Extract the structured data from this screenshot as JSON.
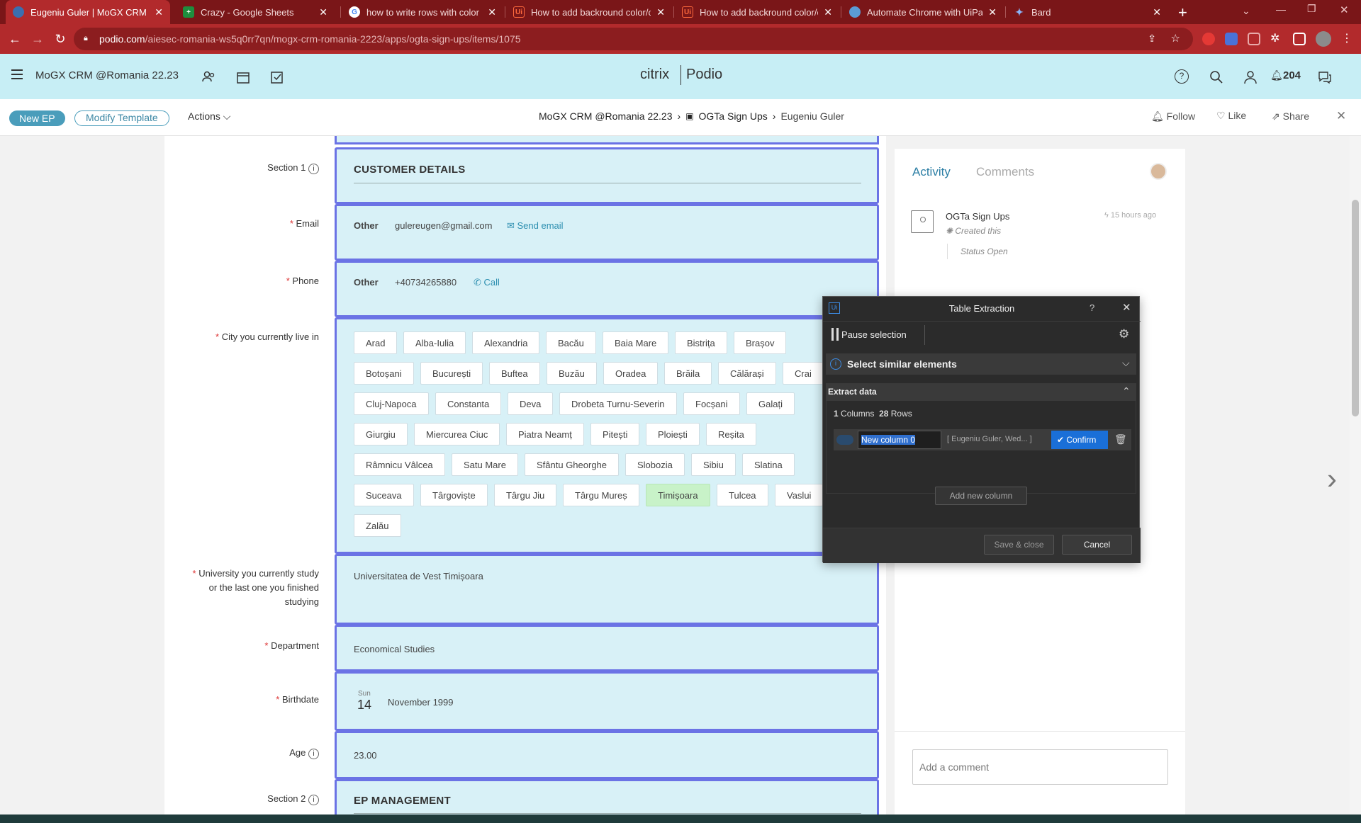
{
  "browser": {
    "tabs": [
      {
        "title": "Eugeniu Guler | MoGX CRM @R",
        "active": true
      },
      {
        "title": "Crazy - Google Sheets"
      },
      {
        "title": "how to write rows with color in"
      },
      {
        "title": "How to add backround color/ce"
      },
      {
        "title": "How to add backround color/ce"
      },
      {
        "title": "Automate Chrome with UiPath"
      },
      {
        "title": "Bard"
      }
    ],
    "url_host": "podio.com",
    "url_path": "/aiesec-romania-ws5q0rr7qn/mogx-crm-romania-2223/apps/ogta-sign-ups/items/1075"
  },
  "header": {
    "workspace": "MoGX CRM @Romania 22.23",
    "logo_left": "citrix",
    "logo_right": "Podio",
    "notifications": "204"
  },
  "toolbar": {
    "new_ep": "New EP",
    "modify_template": "Modify Template",
    "actions": "Actions",
    "breadcrumb": [
      "MoGX CRM @Romania 22.23",
      "OGTa Sign Ups",
      "Eugeniu Guler"
    ],
    "follow": "Follow",
    "like": "Like",
    "share": "Share"
  },
  "form": {
    "section1_label": "Section 1",
    "section1_title": "CUSTOMER DETAILS",
    "email_label": "Email",
    "email_type": "Other",
    "email_value": "gulereugen@gmail.com",
    "send_email": "Send email",
    "phone_label": "Phone",
    "phone_type": "Other",
    "phone_value": "+40734265880",
    "call": "Call",
    "city_label": "City you currently live in",
    "cities": [
      "Arad",
      "Alba-Iulia",
      "Alexandria",
      "Bacău",
      "Baia Mare",
      "Bistrița",
      "Brașov",
      "Botoșani",
      "București",
      "Buftea",
      "Buzău",
      "Oradea",
      "Brăila",
      "Călărași",
      "Crai",
      "Cluj-Napoca",
      "Constanta",
      "Deva",
      "Drobeta Turnu-Severin",
      "Focșani",
      "Galați",
      "Giurgiu",
      "Miercurea Ciuc",
      "Piatra Neamț",
      "Pitești",
      "Ploiești",
      "Reșita",
      "Râmnicu Vâlcea",
      "Satu Mare",
      "Sfântu Gheorghe",
      "Slobozia",
      "Sibiu",
      "Slatina",
      "Suceava",
      "Târgoviște",
      "Târgu Jiu",
      "Târgu Mureș",
      "Timișoara",
      "Tulcea",
      "Vaslui",
      "Zalău"
    ],
    "selected_city": "Timișoara",
    "university_label_1": "University you currently study",
    "university_label_2": "or the last one you finished",
    "university_label_3": "studying",
    "university_value": "Universitatea de Vest Timișoara",
    "department_label": "Department",
    "department_value": "Economical Studies",
    "birthdate_label": "Birthdate",
    "birth_dow": "Sun",
    "birth_day": "14",
    "birth_monthyear": "November 1999",
    "age_label": "Age",
    "age_value": "23.00",
    "section2_label": "Section 2",
    "section2_title": "EP MANAGEMENT"
  },
  "activity": {
    "tab_activity": "Activity",
    "tab_comments": "Comments",
    "app_name": "OGTa Sign Ups",
    "time": "15 hours ago",
    "action": "Created this",
    "status_key": "Status",
    "status_value": "Open",
    "comment_placeholder": "Add a comment"
  },
  "dialog": {
    "title": "Table Extraction",
    "help": "?",
    "pause": "Pause selection",
    "select_similar": "Select similar elements",
    "extract_data": "Extract data",
    "columns_count": "1",
    "columns_word": "Columns",
    "rows_count": "28",
    "rows_word": "Rows",
    "column_name": "New column 0",
    "column_preview": "[ Eugeniu Guler, Wed... ]",
    "confirm": "Confirm",
    "add_column": "Add new column",
    "save_close": "Save & close",
    "cancel": "Cancel"
  }
}
